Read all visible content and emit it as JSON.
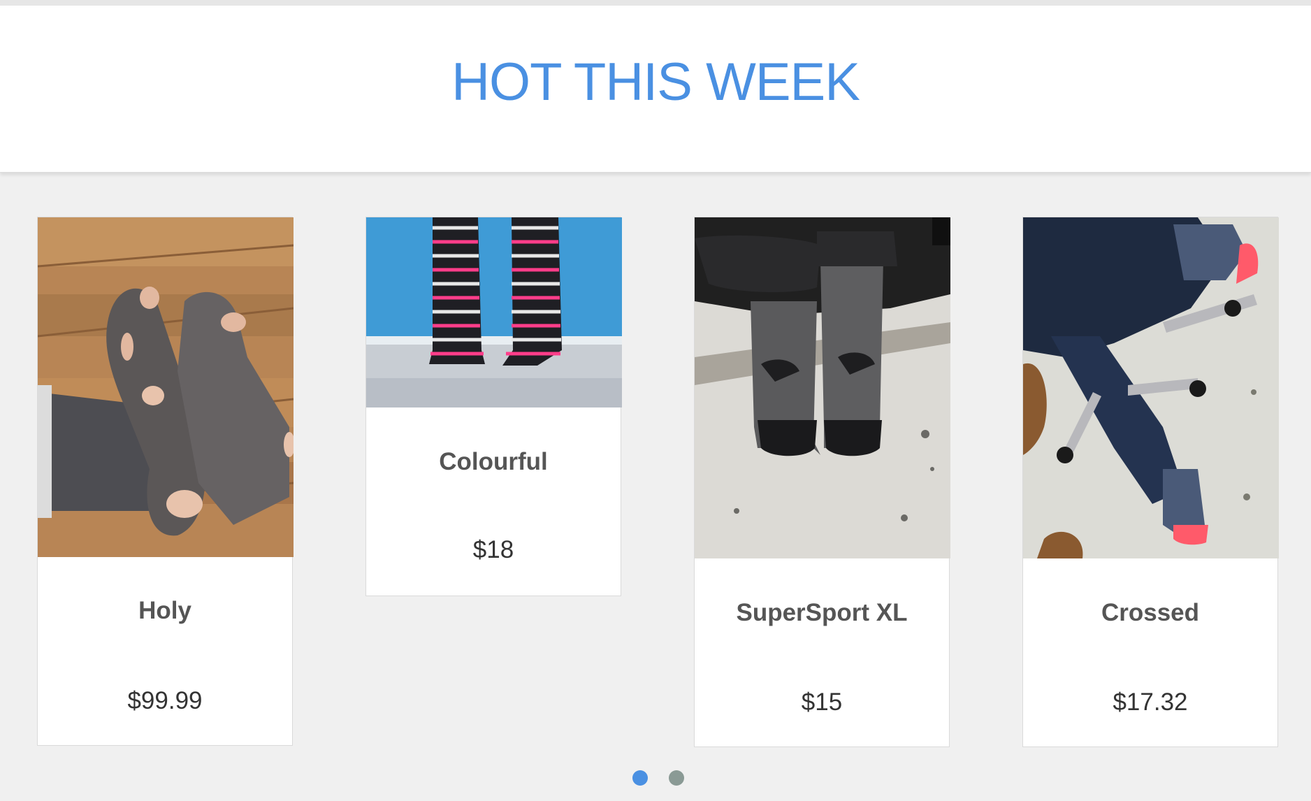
{
  "section": {
    "title": "HOT THIS WEEK"
  },
  "products": [
    {
      "name": "Holy",
      "price": "$99.99",
      "image": "torn-grey-socks-photo"
    },
    {
      "name": "Colourful",
      "price": "$18",
      "image": "striped-socks-photo"
    },
    {
      "name": "SuperSport XL",
      "price": "$15",
      "image": "grey-sport-socks-photo"
    },
    {
      "name": "Crossed",
      "price": "$17.32",
      "image": "crossed-legs-socks-photo"
    }
  ],
  "carousel": {
    "pages": 2,
    "active_index": 0,
    "active_color": "#4a90e2",
    "inactive_color": "#8a9a95"
  },
  "colors": {
    "accent": "#4a90e2",
    "background": "#f0f0f0"
  }
}
